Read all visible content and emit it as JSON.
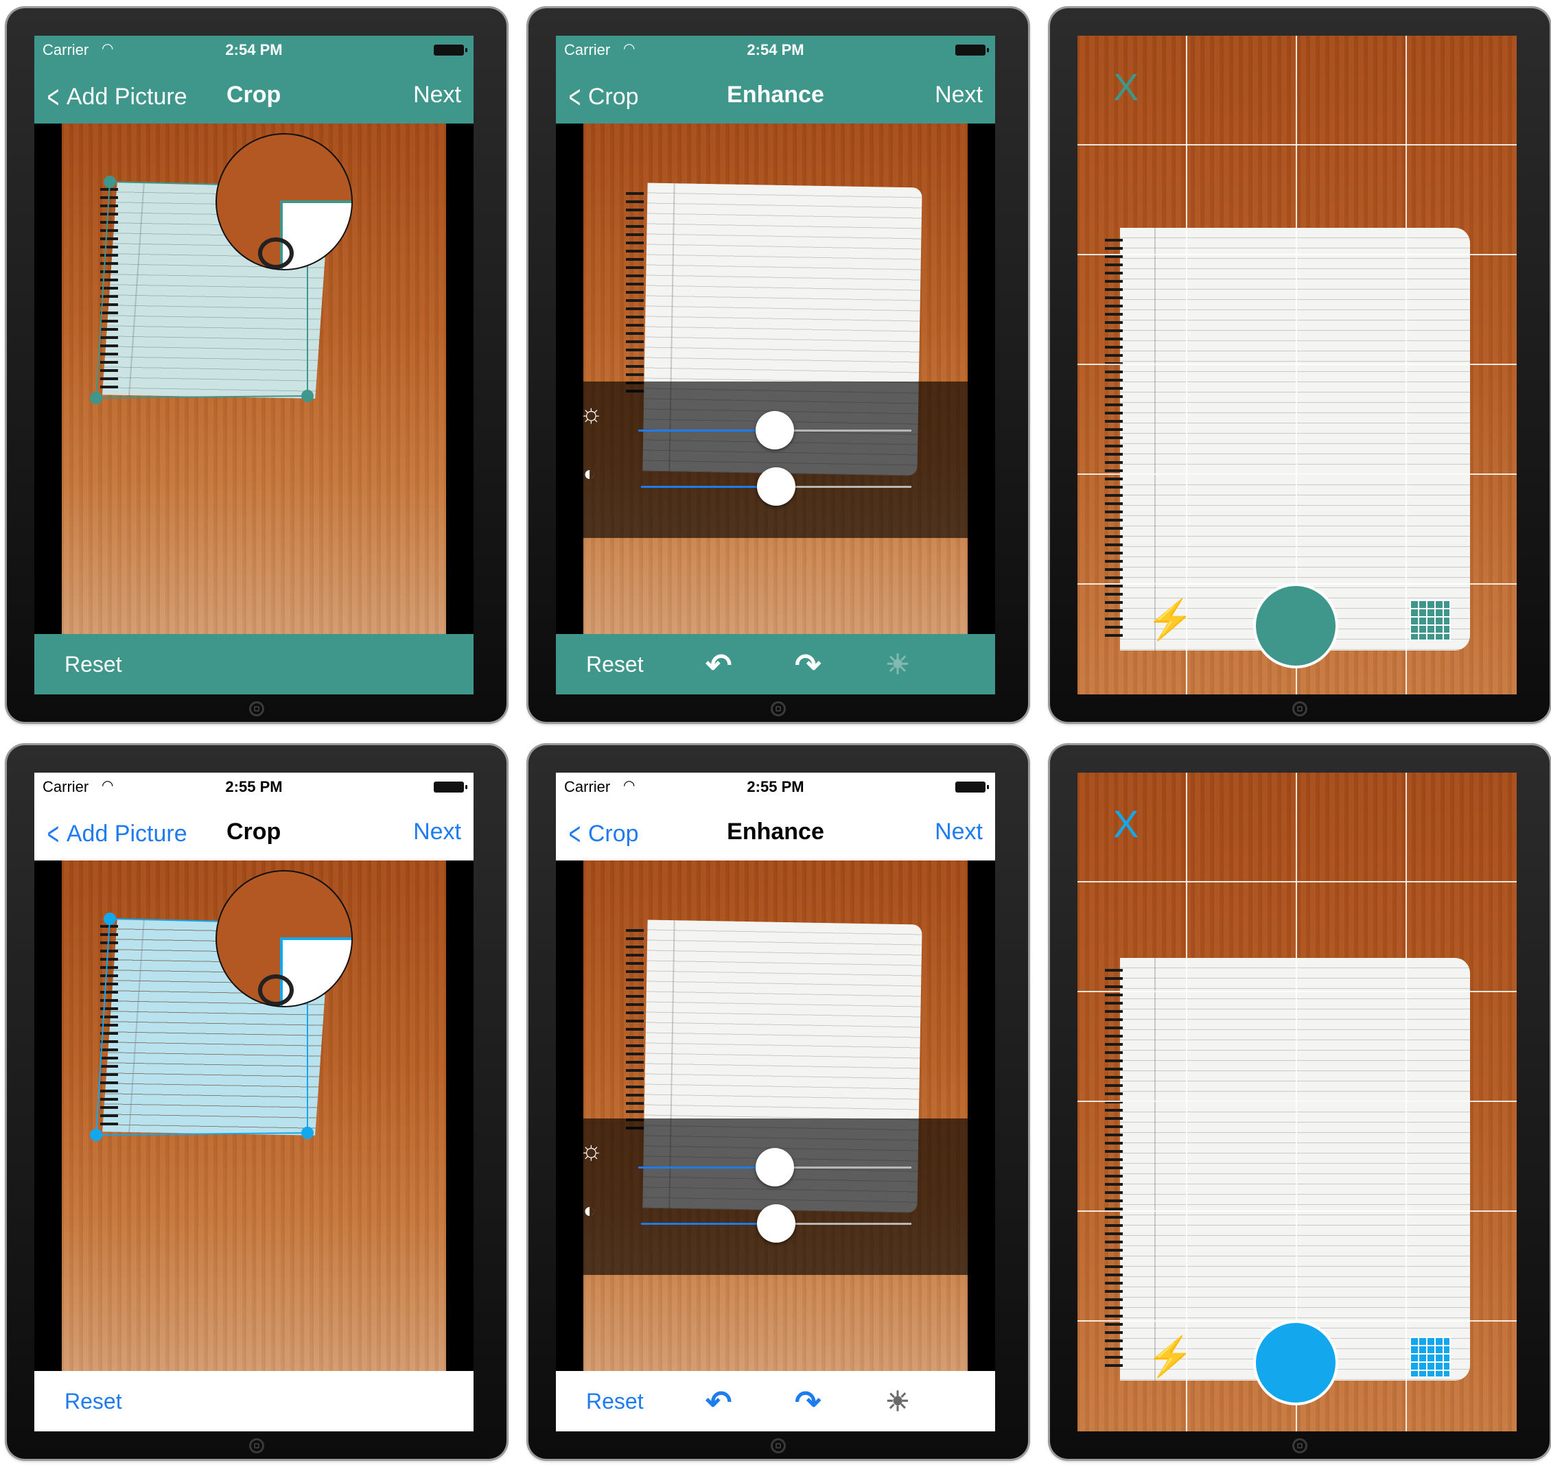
{
  "colors": {
    "teal": "#3f968a",
    "blue": "#1e7cf0",
    "white": "#ffffff",
    "cyan": "#13a7ee",
    "crop_fill_teal": "#cce3e4",
    "crop_fill_blue": "#b9e2ef"
  },
  "screens": [
    {
      "theme": "teal",
      "status": {
        "carrier": "Carrier",
        "time": "2:54 PM"
      },
      "nav": {
        "back": "Add Picture",
        "title": "Crop",
        "next": "Next"
      },
      "toolbar": {
        "reset": "Reset"
      }
    },
    {
      "theme": "teal",
      "status": {
        "carrier": "Carrier",
        "time": "2:54 PM"
      },
      "nav": {
        "back": "Crop",
        "title": "Enhance",
        "next": "Next"
      },
      "toolbar": {
        "reset": "Reset"
      },
      "sliders": {
        "brightness": 0.5,
        "contrast": 0.5
      }
    },
    {
      "theme": "teal",
      "camera": {
        "close": "X"
      }
    },
    {
      "theme": "white",
      "status": {
        "carrier": "Carrier",
        "time": "2:55 PM"
      },
      "nav": {
        "back": "Add Picture",
        "title": "Crop",
        "next": "Next"
      },
      "toolbar": {
        "reset": "Reset"
      }
    },
    {
      "theme": "white",
      "status": {
        "carrier": "Carrier",
        "time": "2:55 PM"
      },
      "nav": {
        "back": "Crop",
        "title": "Enhance",
        "next": "Next"
      },
      "toolbar": {
        "reset": "Reset"
      },
      "sliders": {
        "brightness": 0.5,
        "contrast": 0.5
      }
    },
    {
      "theme": "white",
      "camera": {
        "close": "X"
      }
    }
  ],
  "icons": [
    "back-chevron-icon",
    "wifi-icon",
    "battery-icon",
    "brightness-icon",
    "contrast-icon",
    "rotate-left-icon",
    "rotate-right-icon",
    "auto-enhance-icon",
    "close-icon",
    "flash-icon",
    "shutter-icon",
    "grid-icon"
  ]
}
